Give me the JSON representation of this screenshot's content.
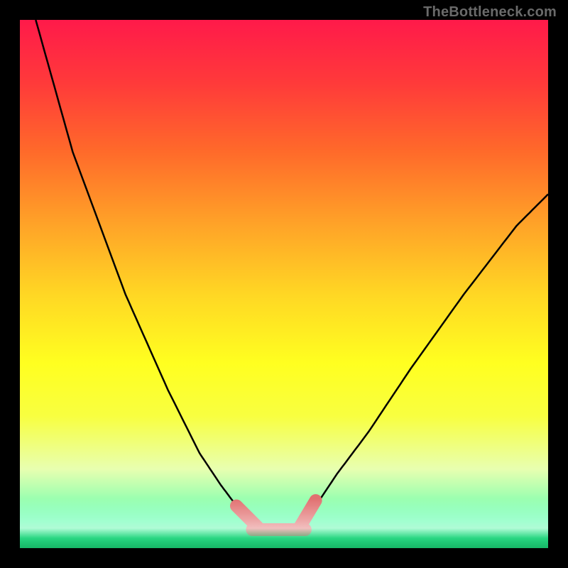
{
  "watermark": "TheBottleneck.com",
  "chart_data": {
    "type": "line",
    "title": "",
    "xlabel": "",
    "ylabel": "",
    "xlim": [
      0,
      100
    ],
    "ylim": [
      0,
      100
    ],
    "grid": false,
    "legend": false,
    "background_gradient": [
      "#ff1a4a",
      "#ffff20",
      "#20e080"
    ],
    "series": [
      {
        "name": "left-curve",
        "color": "#000000",
        "x": [
          3,
          10,
          20,
          28,
          34,
          38,
          41,
          44,
          45
        ],
        "y": [
          100,
          75,
          48,
          30,
          18,
          12,
          8,
          5,
          4
        ]
      },
      {
        "name": "right-curve",
        "color": "#000000",
        "x": [
          54,
          56,
          60,
          66,
          74,
          84,
          94,
          100
        ],
        "y": [
          4,
          8,
          14,
          22,
          34,
          48,
          61,
          67
        ]
      },
      {
        "name": "bottom-marker-left",
        "color": "#e17070",
        "style": "thick-rounded",
        "x": [
          41,
          45
        ],
        "y": [
          8,
          4
        ]
      },
      {
        "name": "bottom-marker-flat",
        "color": "#e17070",
        "style": "thick-rounded",
        "x": [
          44,
          54
        ],
        "y": [
          3.5,
          3.5
        ]
      },
      {
        "name": "bottom-marker-right",
        "color": "#e17070",
        "style": "thick-rounded",
        "x": [
          53,
          56
        ],
        "y": [
          4,
          9
        ]
      }
    ]
  }
}
